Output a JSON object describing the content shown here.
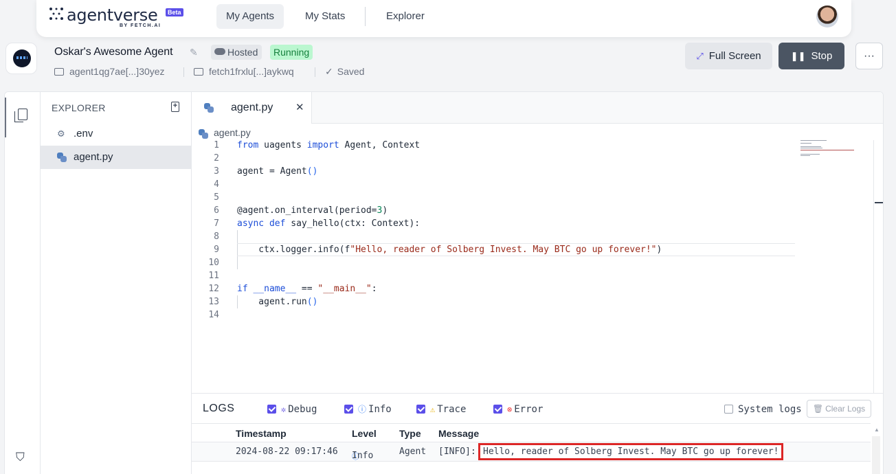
{
  "brand": {
    "wordmark": "agentverse",
    "badge": "Beta",
    "byline": "BY FETCH.AI"
  },
  "nav": {
    "tabs": [
      {
        "label": "My Agents",
        "active": true
      },
      {
        "label": "My Stats",
        "active": false
      },
      {
        "label": "Explorer",
        "active": false
      }
    ]
  },
  "agent": {
    "name": "Oskar's Awesome Agent",
    "hosted_label": "Hosted",
    "status": "Running",
    "address": "agent1qg7ae[...]30yez",
    "wallet": "fetch1frxlu[...]aykwq",
    "saved_label": "Saved"
  },
  "actions": {
    "full_screen": "Full Screen",
    "stop": "Stop",
    "more": "···"
  },
  "explorer": {
    "title": "EXPLORER",
    "files": [
      {
        "name": ".env",
        "icon": "gear-file-icon",
        "active": false
      },
      {
        "name": "agent.py",
        "icon": "python-icon",
        "active": true
      }
    ]
  },
  "editor": {
    "tab_label": "agent.py",
    "breadcrumb": "agent.py",
    "lines": [
      "from uagents import Agent, Context",
      "",
      "agent = Agent()",
      "",
      "",
      "@agent.on_interval(period=3)",
      "async def say_hello(ctx: Context):",
      "",
      "    ctx.logger.info(f\"Hello, reader of Solberg Invest. May BTC go up forever!\")",
      "",
      "",
      "if __name__ == \"__main__\":",
      "    agent.run()",
      ""
    ]
  },
  "logs": {
    "title": "LOGS",
    "filters": [
      {
        "label": "Debug",
        "checked": true,
        "icon": "bug-icon"
      },
      {
        "label": "Info",
        "checked": true,
        "icon": "info-icon"
      },
      {
        "label": "Trace",
        "checked": true,
        "icon": "warning-icon"
      },
      {
        "label": "Error",
        "checked": true,
        "icon": "error-icon"
      }
    ],
    "system_logs_label": "System logs",
    "system_logs_checked": false,
    "clear_label": "Clear Logs",
    "columns": [
      "Timestamp",
      "Level",
      "Type",
      "Message"
    ],
    "rows": [
      {
        "timestamp": "2024-08-22 09:17:46",
        "level": "Info",
        "type": "Agent",
        "prefix": "[INFO]:",
        "message": "Hello, reader of Solberg Invest. May BTC go up forever!"
      }
    ]
  },
  "colors": {
    "accent": "#5b4fe9",
    "running_bg": "#bbf7d0",
    "running_text": "#15803d",
    "highlight": "#dc2626"
  }
}
